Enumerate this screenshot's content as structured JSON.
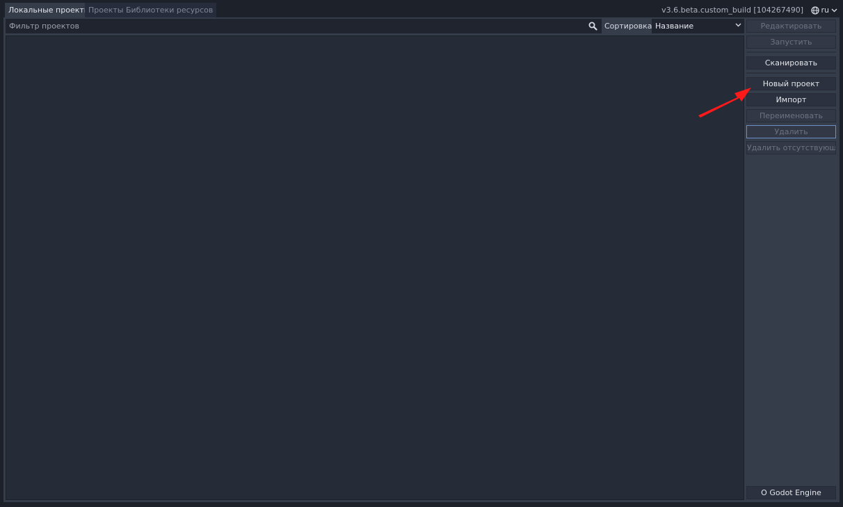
{
  "tabs": [
    {
      "label": "Локальные проекты",
      "active": true
    },
    {
      "label": "Проекты Библиотеки ресурсов",
      "active": false
    }
  ],
  "version": "v3.6.beta.custom_build [104267490]",
  "language": {
    "icon": "globe-icon",
    "value": "ru"
  },
  "filter": {
    "placeholder": "Фильтр проектов",
    "value": ""
  },
  "sort": {
    "label": "Сортировка:",
    "selected": "Название"
  },
  "sidebar": {
    "edit_label": "Редактировать",
    "run_label": "Запустить",
    "scan_label": "Сканировать",
    "new_project_label": "Новый проект",
    "import_label": "Импорт",
    "rename_label": "Переименовать",
    "remove_label": "Удалить",
    "remove_missing_label": "Удалить отсутствующие",
    "about_label": "О Godot Engine"
  },
  "colors": {
    "background": "#1d2129",
    "panel": "#363d4a",
    "list": "#262b38",
    "accent": "#6c8fc9",
    "annotation": "#ff1a1a"
  }
}
